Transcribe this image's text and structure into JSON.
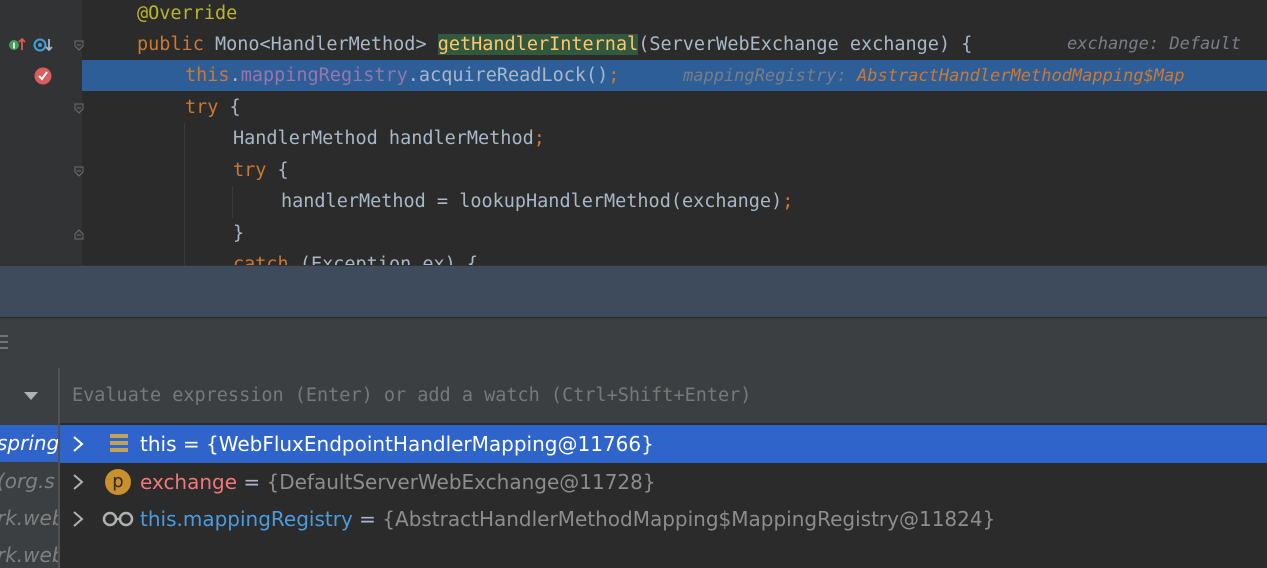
{
  "editor": {
    "line1": {
      "annotation": "@Override"
    },
    "line2": {
      "kw_public": "public",
      "type": " Mono<HandlerMethod> ",
      "method": "getHandlerInternal",
      "params": "(ServerWebExchange exchange) {",
      "hint": "exchange: Default"
    },
    "line3": {
      "kw_this": "this",
      "dot": ".",
      "field": "mappingRegistry",
      "call": ".acquireReadLock()",
      "semi": ";",
      "hint_label": "mappingRegistry: ",
      "hint_type": "AbstractHandlerMethodMapping$Map"
    },
    "line4": {
      "kw": "try",
      "rest": " {"
    },
    "line5": {
      "decl": "HandlerMethod handlerMethod",
      "semi": ";"
    },
    "line6": {
      "kw": "try",
      "rest": " {"
    },
    "line7": {
      "stmt": "handlerMethod = lookupHandlerMethod(exchange)",
      "semi": ";"
    },
    "line8": {
      "brace": "}"
    },
    "line9": {
      "kw": "catch",
      "rest": " (Exception ex) {"
    }
  },
  "frames": {
    "items": [
      {
        "label": "spring"
      },
      {
        "label": "(org.s"
      },
      {
        "label": "rk.web"
      },
      {
        "label": "rk.web"
      }
    ]
  },
  "evaluate": {
    "placeholder": "Evaluate expression (Enter) or add a watch (Ctrl+Shift+Enter)"
  },
  "variables": [
    {
      "icon": "field-icon",
      "name": "this",
      "eq": " = ",
      "value": "{WebFluxEndpointHandlerMapping@11766}",
      "name_color": "#ffffff"
    },
    {
      "icon": "parameter-icon",
      "badge": "p",
      "name": "exchange",
      "eq": " = ",
      "value": "{DefaultServerWebExchange@11728}",
      "name_color": "#ef7878"
    },
    {
      "icon": "watch-icon",
      "name": "this.mappingRegistry",
      "eq": " = ",
      "value": "{AbstractHandlerMethodMapping$MappingRegistry@11824}",
      "name_color": "#4a9ce0"
    }
  ],
  "colors": {
    "selection": "#2f65ca",
    "editor_bg": "#2b2b2b",
    "current_line": "#2d5e98"
  }
}
